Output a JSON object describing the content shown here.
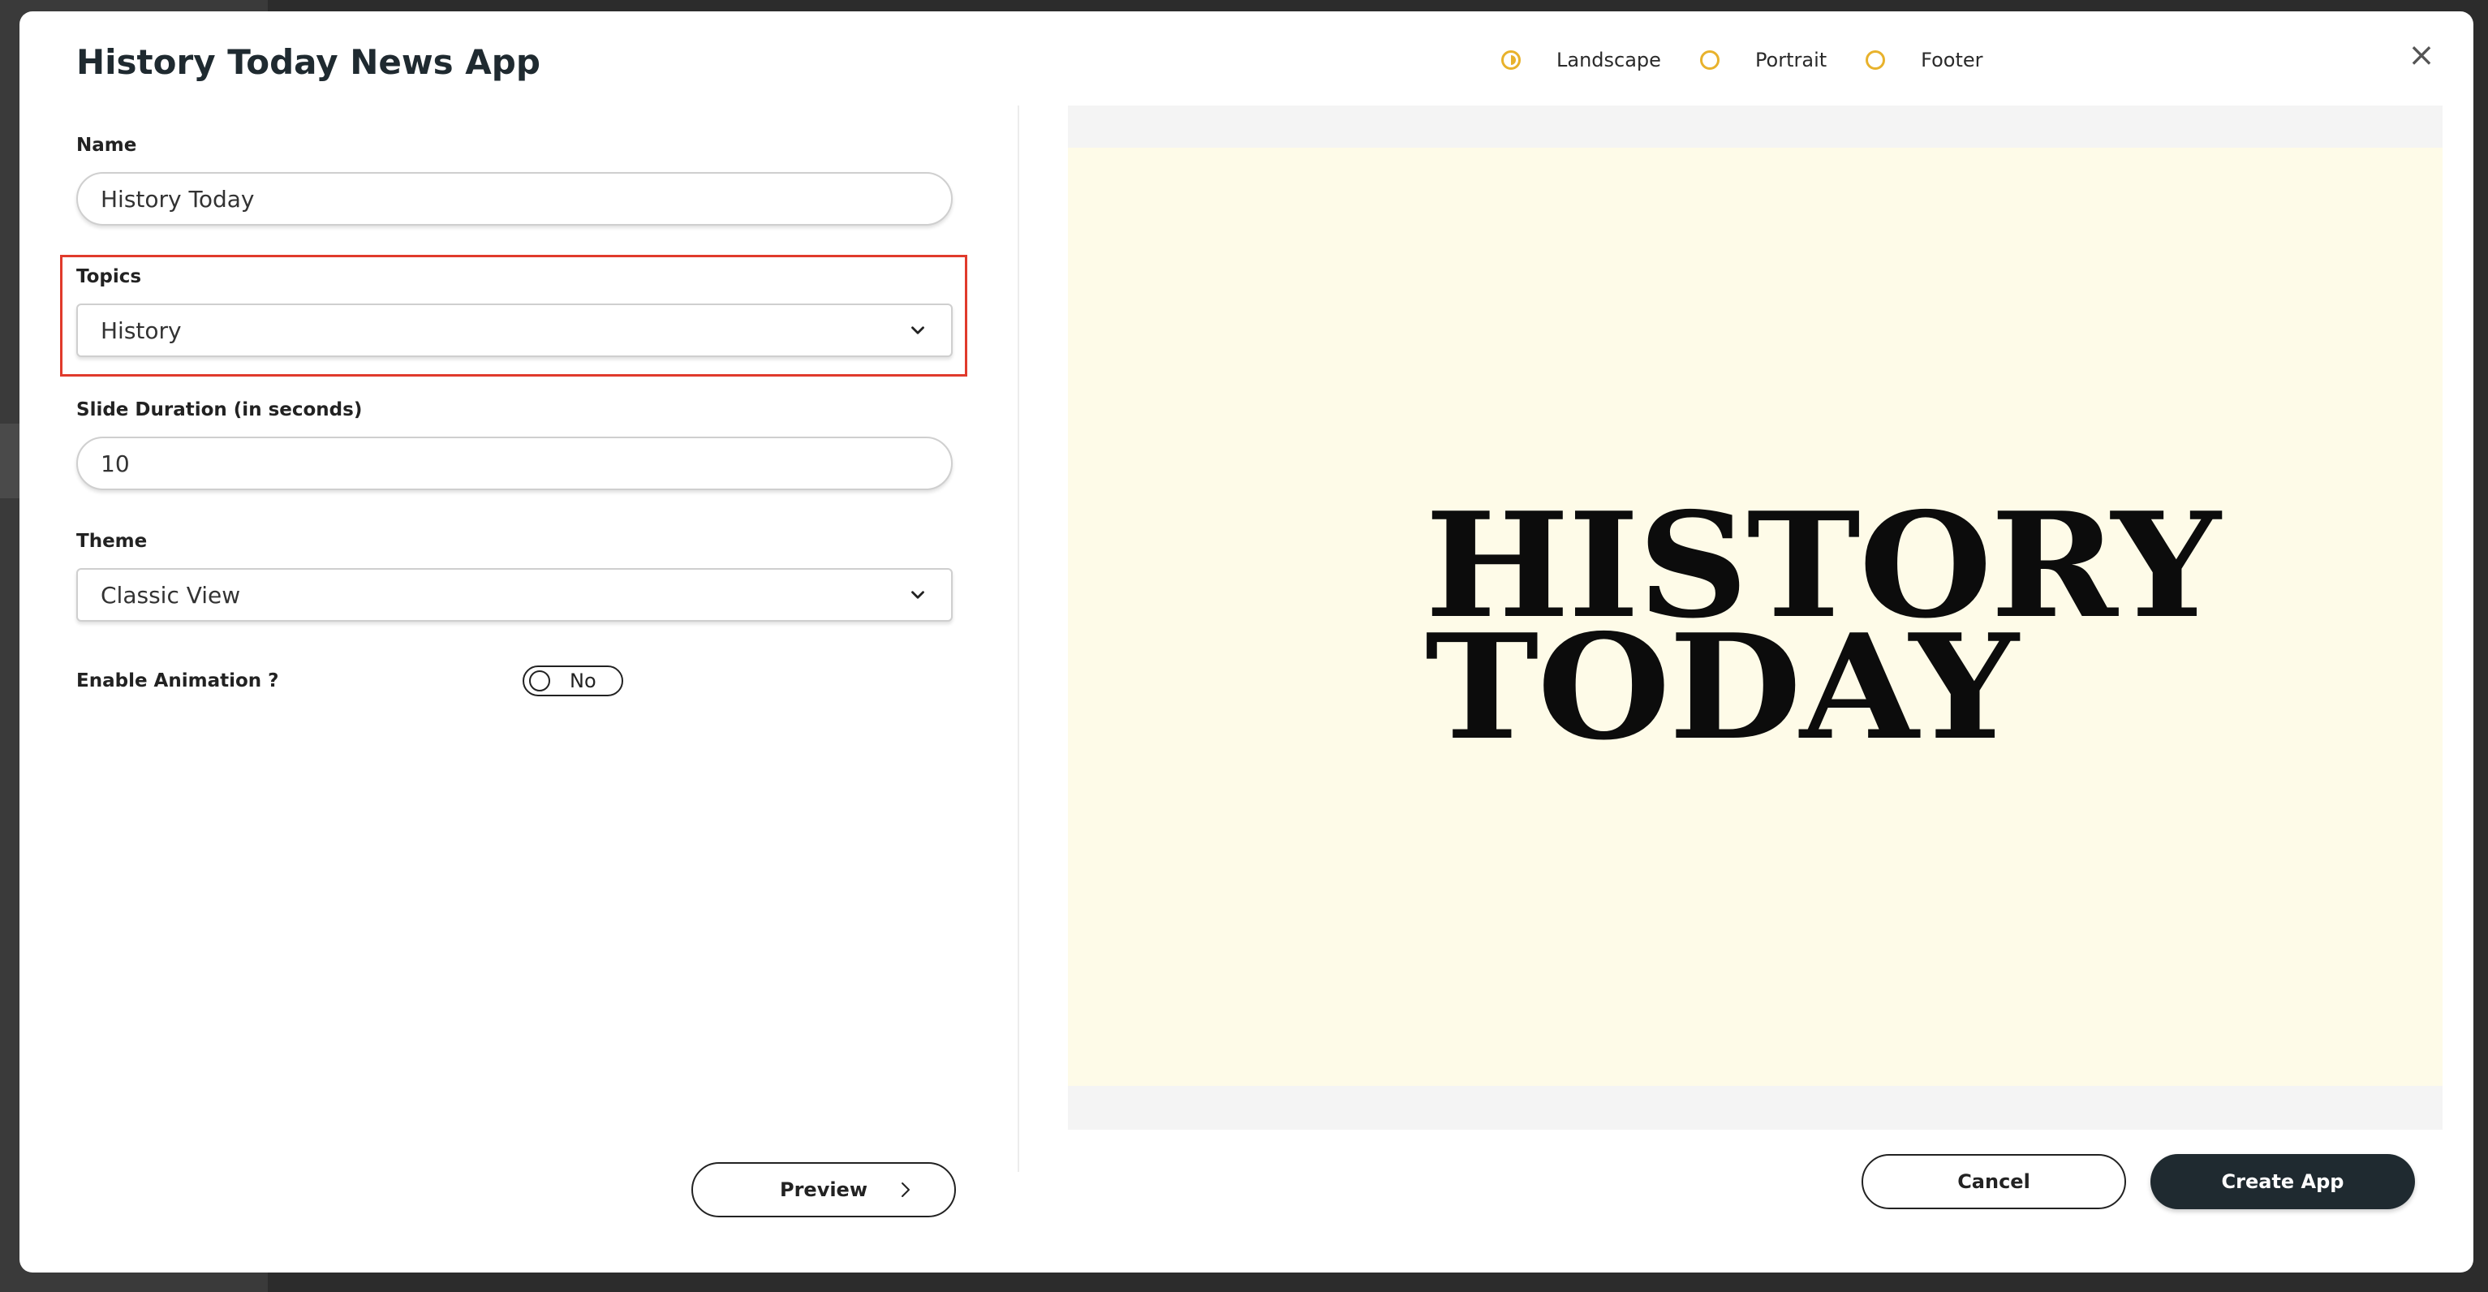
{
  "modal": {
    "title": "History Today News App",
    "close_icon": "×"
  },
  "orientation": {
    "options": [
      {
        "label": "Landscape",
        "selected": true
      },
      {
        "label": "Portrait",
        "selected": false
      },
      {
        "label": "Footer",
        "selected": false
      }
    ]
  },
  "form": {
    "name": {
      "label": "Name",
      "value": "History Today"
    },
    "topics": {
      "label": "Topics",
      "value": "History"
    },
    "slide_duration": {
      "label": "Slide Duration (in seconds)",
      "value": "10"
    },
    "theme": {
      "label": "Theme",
      "value": "Classic View"
    },
    "animation": {
      "label": "Enable Animation ?",
      "value": "No"
    }
  },
  "preview": {
    "button_label": "Preview",
    "headline_line1": "HISTORY",
    "headline_line2": "TODAY"
  },
  "actions": {
    "cancel_label": "Cancel",
    "create_label": "Create App"
  },
  "colors": {
    "accent": "#e8b22c",
    "highlight": "#e03a2c",
    "primary_button": "#1f2a30",
    "slide_background": "#fefbe8"
  }
}
